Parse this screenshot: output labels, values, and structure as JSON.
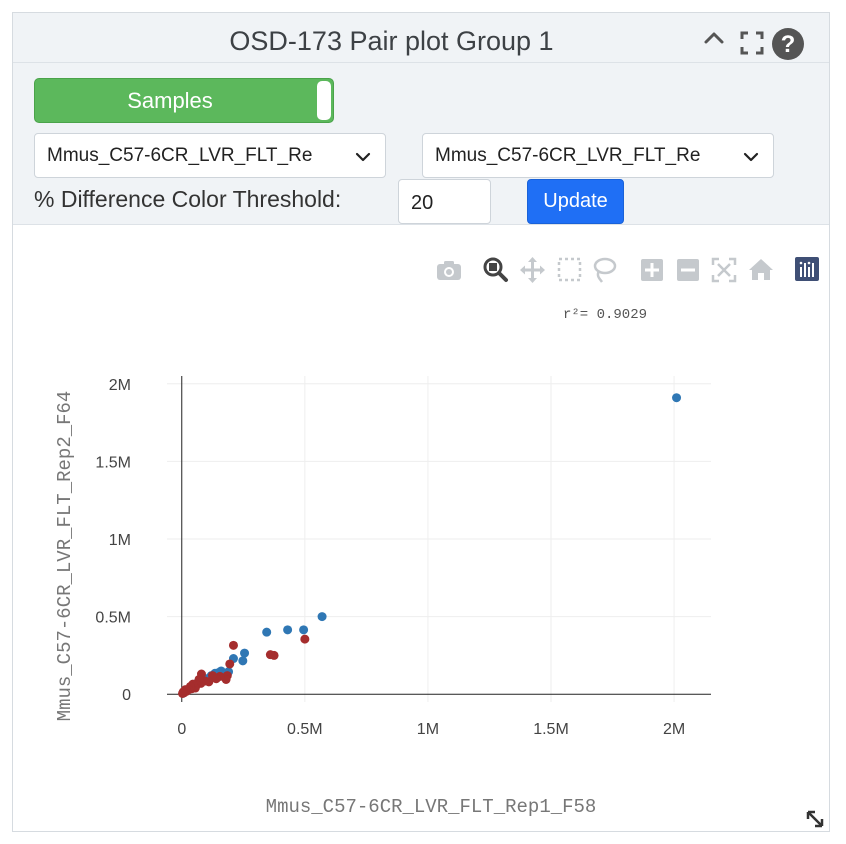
{
  "widget": {
    "title": "OSD-173 Pair plot Group 1"
  },
  "icons": {
    "collapse": "chevron-up-icon",
    "expand": "fullscreen-icon",
    "help": "help-circle-icon",
    "resize": "resize-diagonal-icon"
  },
  "controls": {
    "toggle_label": "Samples",
    "sample_x_value": "Mmus_C57-6CR_LVR_FLT_Rep1_F58",
    "sample_y_value": "Mmus_C57-6CR_LVR_FLT_Rep2_F64",
    "sample_x_display": "Mmus_C57-6CR_LVR_FLT_Re",
    "sample_y_display": "Mmus_C57-6CR_LVR_FLT_Re",
    "threshold_label": "% Difference Color Threshold:",
    "threshold_value": "20",
    "update_label": "Update"
  },
  "modebar": [
    "camera-icon",
    "zoom-icon",
    "pan-icon",
    "box-select-icon",
    "lasso-icon",
    "zoom-in-icon",
    "zoom-out-icon",
    "autoscale-icon",
    "reset-axes-icon",
    "plotly-logo-icon"
  ],
  "colors": {
    "within_threshold": "#2f77b4",
    "above_threshold": "#a52d2d",
    "toggle_green": "#5cb85c",
    "update_blue": "#1f6ff5"
  },
  "chart_data": {
    "type": "scatter",
    "annotation": "r²= 0.9029",
    "xlabel": "Mmus_C57-6CR_LVR_FLT_Rep1_F58",
    "ylabel": "Mmus_C57-6CR_LVR_FLT_Rep2_F64",
    "xlim": [
      -60000,
      2150000
    ],
    "ylim": [
      -50000,
      2050000
    ],
    "xticks": [
      0,
      500000,
      1000000,
      1500000,
      2000000
    ],
    "xtick_labels": [
      "0",
      "0.5M",
      "1M",
      "1.5M",
      "2M"
    ],
    "yticks": [
      0,
      500000,
      1000000,
      1500000,
      2000000
    ],
    "ytick_labels": [
      "0",
      "0.5M",
      "1M",
      "1.5M",
      "2M"
    ],
    "grid": true,
    "series": [
      {
        "color": "#2f77b4",
        "x": [
          2010000,
          570000,
          495000,
          430000,
          345000,
          255000,
          248000,
          210000,
          190000,
          160000,
          150000,
          135000,
          120000,
          100000,
          80000,
          60000,
          45000,
          35000,
          25000,
          15000,
          10000,
          5000
        ],
        "y": [
          1910000,
          500000,
          415000,
          415000,
          400000,
          265000,
          215000,
          230000,
          145000,
          150000,
          140000,
          135000,
          120000,
          100000,
          80000,
          70000,
          55000,
          40000,
          30000,
          20000,
          12000,
          6000
        ]
      },
      {
        "color": "#a52d2d",
        "x": [
          500000,
          375000,
          360000,
          210000,
          195000,
          185000,
          180000,
          155000,
          140000,
          125000,
          110000,
          95000,
          80000,
          78000,
          70000,
          60000,
          55000,
          45000,
          40000,
          35000,
          28000,
          20000,
          15000,
          10000,
          6000,
          3000
        ],
        "y": [
          355000,
          250000,
          255000,
          315000,
          195000,
          120000,
          95000,
          115000,
          100000,
          120000,
          80000,
          85000,
          130000,
          70000,
          95000,
          60000,
          40000,
          65000,
          35000,
          50000,
          30000,
          20000,
          30000,
          10000,
          15000,
          5000
        ]
      }
    ]
  }
}
